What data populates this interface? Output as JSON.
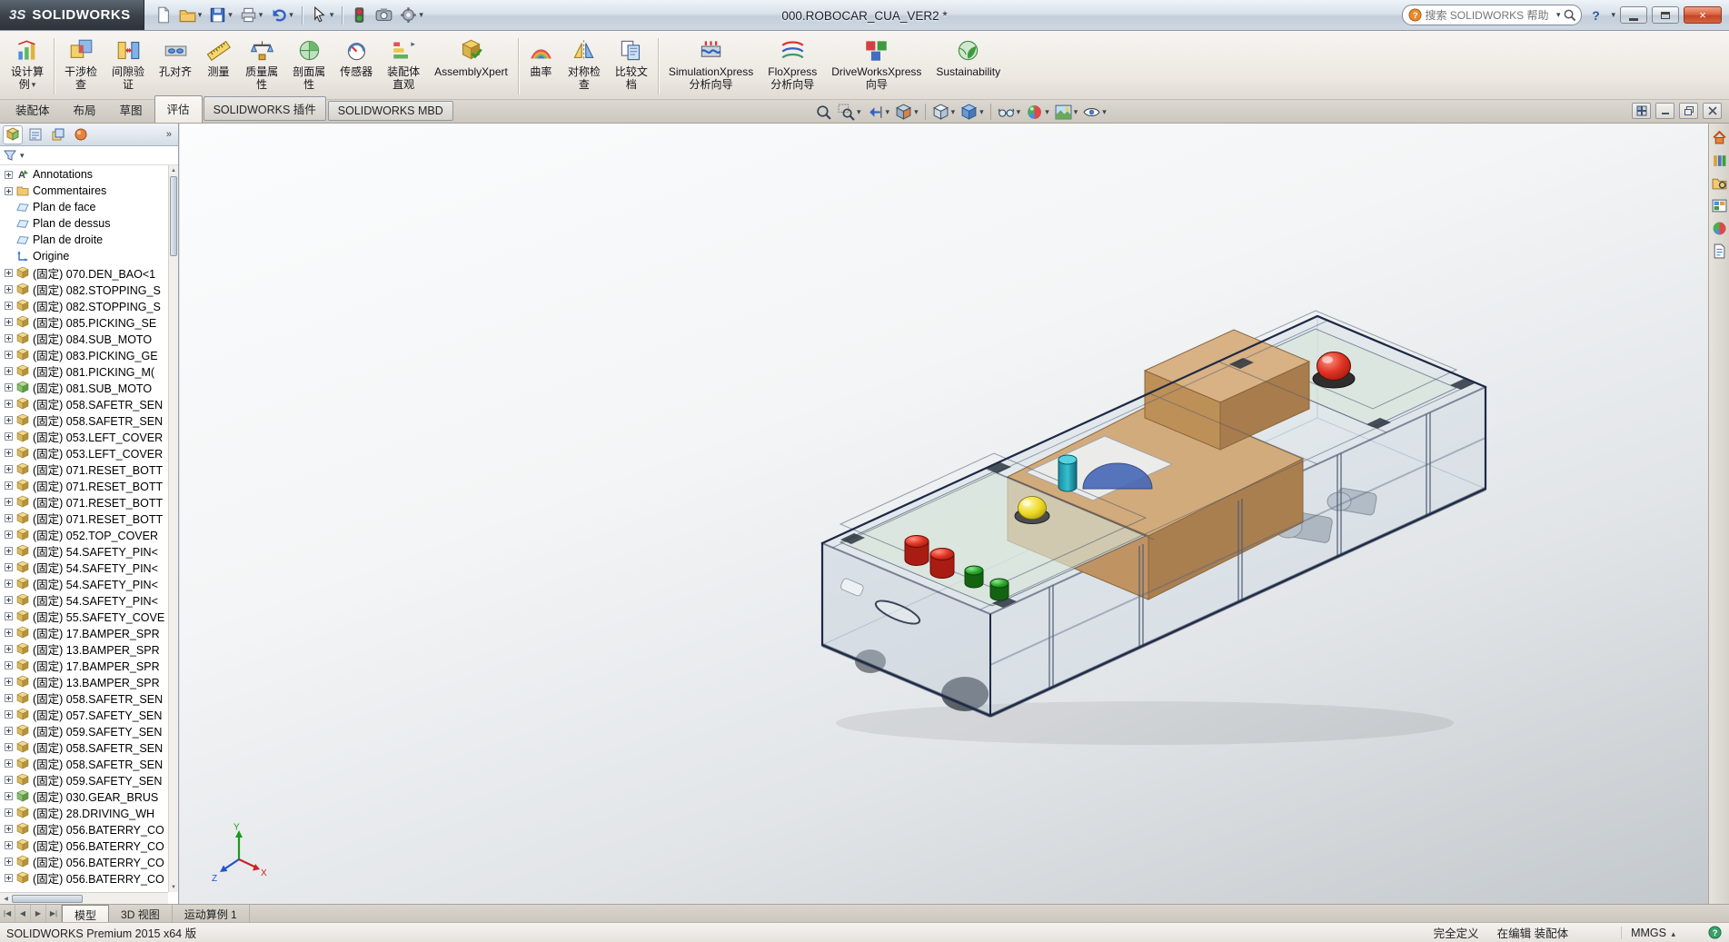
{
  "glyphs": {
    "caret_down": "▾",
    "caret_up": "▴",
    "chevron": "»",
    "up": "▲",
    "down": "▼",
    "left": "◀",
    "right": "▶"
  },
  "window": {
    "brand_mark": "3S",
    "brand": "SOLIDWORKS",
    "title": "000.ROBOCAR_CUA_VER2 *",
    "search": {
      "placeholder": "搜索 SOLIDWORKS 帮助"
    },
    "controls": {
      "help": "?",
      "close": "×"
    }
  },
  "quick_access": [
    {
      "icon": "new-document"
    },
    {
      "icon": "open-folder",
      "caret": true
    },
    {
      "icon": "save",
      "caret": true
    },
    {
      "icon": "print",
      "caret": true
    },
    {
      "icon": "undo",
      "caret": true
    },
    {
      "icon": "sep"
    },
    {
      "icon": "select-cursor",
      "caret": true
    },
    {
      "icon": "sep"
    },
    {
      "icon": "rebuild"
    },
    {
      "icon": "screen-capture"
    },
    {
      "icon": "options-gear",
      "caret": true
    }
  ],
  "ribbon": {
    "buttons": [
      {
        "icon": "design-study",
        "lines": [
          "设计算",
          "例"
        ],
        "caret": true,
        "sep_after": true
      },
      {
        "icon": "interference-check",
        "lines": [
          "干涉检",
          "查"
        ]
      },
      {
        "icon": "clearance-verify",
        "lines": [
          "间隙验",
          "证"
        ]
      },
      {
        "icon": "hole-alignment",
        "lines": [
          "孔对齐"
        ]
      },
      {
        "icon": "measure",
        "lines": [
          "测量"
        ]
      },
      {
        "icon": "mass-properties",
        "lines": [
          "质量属",
          "性"
        ]
      },
      {
        "icon": "section-properties",
        "lines": [
          "剖面属",
          "性"
        ]
      },
      {
        "icon": "sensor",
        "lines": [
          "传感器"
        ]
      },
      {
        "icon": "assembly-visualization",
        "lines": [
          "装配体",
          "直观"
        ]
      },
      {
        "icon": "assembly-xpert",
        "lines": [
          "AssemblyXpert"
        ],
        "sep_after": true
      },
      {
        "icon": "curvature",
        "lines": [
          "曲率"
        ]
      },
      {
        "icon": "symmetry-check",
        "lines": [
          "对称检",
          "查"
        ]
      },
      {
        "icon": "compare-documents",
        "lines": [
          "比较文",
          "档"
        ],
        "sep_after": true
      },
      {
        "icon": "simulationxpress",
        "lines": [
          "SimulationXpress",
          "分析向导"
        ]
      },
      {
        "icon": "floxpress",
        "lines": [
          "FloXpress",
          "分析向导"
        ]
      },
      {
        "icon": "driveworksxpress",
        "lines": [
          "DriveWorksXpress",
          "向导"
        ]
      },
      {
        "icon": "sustainability",
        "lines": [
          "Sustainability"
        ]
      }
    ]
  },
  "command_tabs": [
    {
      "label": "装配体"
    },
    {
      "label": "布局"
    },
    {
      "label": "草图"
    },
    {
      "label": "评估",
      "active": true
    },
    {
      "label": "SOLIDWORKS 插件",
      "boxed": true
    },
    {
      "label": "SOLIDWORKS MBD",
      "boxed": true
    }
  ],
  "headsup": [
    {
      "icon": "zoom-fit"
    },
    {
      "icon": "zoom-area",
      "caret": true
    },
    {
      "icon": "previous-view",
      "caret": true
    },
    {
      "icon": "section-view",
      "caret": true
    },
    {
      "icon": "sep"
    },
    {
      "icon": "view-orientation",
      "caret": true
    },
    {
      "icon": "display-style",
      "caret": true
    },
    {
      "icon": "sep"
    },
    {
      "icon": "hide-show-items",
      "caret": true
    },
    {
      "icon": "edit-appearance",
      "caret": true
    },
    {
      "icon": "apply-scene",
      "caret": true
    },
    {
      "icon": "view-settings",
      "caret": true
    }
  ],
  "document_controls": [
    {
      "icon": "doc-tile"
    },
    {
      "icon": "doc-minimize"
    },
    {
      "icon": "doc-restore"
    },
    {
      "icon": "doc-close"
    }
  ],
  "panel": {
    "tabs": [
      {
        "icon": "featuremanager-tab",
        "active": true
      },
      {
        "icon": "propertymanager-tab"
      },
      {
        "icon": "configurationmanager-tab"
      },
      {
        "icon": "displaymanager-tab"
      }
    ]
  },
  "tree": {
    "items": [
      {
        "icon": "annotations",
        "label": "Annotations",
        "expandable": true
      },
      {
        "icon": "comments",
        "label": "Commentaires",
        "expandable": true
      },
      {
        "icon": "plane",
        "label": "Plan de face",
        "expandable": false
      },
      {
        "icon": "plane",
        "label": "Plan de dessus",
        "expandable": false
      },
      {
        "icon": "plane",
        "label": "Plan de droite",
        "expandable": false
      },
      {
        "icon": "origin",
        "label": "Origine",
        "expandable": false
      },
      {
        "icon": "part",
        "label": "(固定) 070.DEN_BAO<1",
        "expandable": true
      },
      {
        "icon": "part",
        "label": "(固定) 082.STOPPING_S",
        "expandable": true
      },
      {
        "icon": "part",
        "label": "(固定) 082.STOPPING_S",
        "expandable": true
      },
      {
        "icon": "part",
        "label": "(固定) 085.PICKING_SE",
        "expandable": true
      },
      {
        "icon": "part",
        "label": "(固定) 084.SUB_MOTO",
        "expandable": true
      },
      {
        "icon": "part",
        "label": "(固定) 083.PICKING_GE",
        "expandable": true
      },
      {
        "icon": "part",
        "label": "(固定) 081.PICKING_M(",
        "expandable": true
      },
      {
        "icon": "part-green",
        "label": "(固定) 081.SUB_MOTO",
        "expandable": true
      },
      {
        "icon": "part",
        "label": "(固定) 058.SAFETR_SEN",
        "expandable": true
      },
      {
        "icon": "part",
        "label": "(固定) 058.SAFETR_SEN",
        "expandable": true
      },
      {
        "icon": "part",
        "label": "(固定) 053.LEFT_COVER",
        "expandable": true
      },
      {
        "icon": "part",
        "label": "(固定) 053.LEFT_COVER",
        "expandable": true
      },
      {
        "icon": "part",
        "label": "(固定) 071.RESET_BOTT",
        "expandable": true
      },
      {
        "icon": "part",
        "label": "(固定) 071.RESET_BOTT",
        "expandable": true
      },
      {
        "icon": "part",
        "label": "(固定) 071.RESET_BOTT",
        "expandable": true
      },
      {
        "icon": "part",
        "label": "(固定) 071.RESET_BOTT",
        "expandable": true
      },
      {
        "icon": "part",
        "label": "(固定) 052.TOP_COVER",
        "expandable": true
      },
      {
        "icon": "part",
        "label": "(固定) 54.SAFETY_PIN<",
        "expandable": true
      },
      {
        "icon": "part",
        "label": "(固定) 54.SAFETY_PIN<",
        "expandable": true
      },
      {
        "icon": "part",
        "label": "(固定) 54.SAFETY_PIN<",
        "expandable": true
      },
      {
        "icon": "part",
        "label": "(固定) 54.SAFETY_PIN<",
        "expandable": true
      },
      {
        "icon": "part",
        "label": "(固定) 55.SAFETY_COVE",
        "expandable": true
      },
      {
        "icon": "part",
        "label": "(固定) 17.BAMPER_SPR",
        "expandable": true
      },
      {
        "icon": "part",
        "label": "(固定) 13.BAMPER_SPR",
        "expandable": true
      },
      {
        "icon": "part",
        "label": "(固定) 17.BAMPER_SPR",
        "expandable": true
      },
      {
        "icon": "part",
        "label": "(固定) 13.BAMPER_SPR",
        "expandable": true
      },
      {
        "icon": "part",
        "label": "(固定) 058.SAFETR_SEN",
        "expandable": true
      },
      {
        "icon": "part",
        "label": "(固定) 057.SAFETY_SEN",
        "expandable": true
      },
      {
        "icon": "part",
        "label": "(固定) 059.SAFETY_SEN",
        "expandable": true
      },
      {
        "icon": "part",
        "label": "(固定) 058.SAFETR_SEN",
        "expandable": true
      },
      {
        "icon": "part",
        "label": "(固定) 058.SAFETR_SEN",
        "expandable": true
      },
      {
        "icon": "part",
        "label": "(固定) 059.SAFETY_SEN",
        "expandable": true
      },
      {
        "icon": "part-green",
        "label": "(固定) 030.GEAR_BRUS",
        "expandable": true
      },
      {
        "icon": "part",
        "label": "(固定) 28.DRIVING_WH",
        "expandable": true
      },
      {
        "icon": "part",
        "label": "(固定) 056.BATERRY_CO",
        "expandable": true
      },
      {
        "icon": "part",
        "label": "(固定) 056.BATERRY_CO",
        "expandable": true
      },
      {
        "icon": "part",
        "label": "(固定) 056.BATERRY_CO",
        "expandable": true
      },
      {
        "icon": "part",
        "label": "(固定) 056.BATERRY_CO",
        "expandable": true
      }
    ]
  },
  "task_pane": [
    {
      "icon": "resources"
    },
    {
      "icon": "design-library"
    },
    {
      "icon": "file-explorer"
    },
    {
      "icon": "view-palette"
    },
    {
      "icon": "appearances-scenes"
    },
    {
      "icon": "custom-properties"
    }
  ],
  "triad": {
    "x": "X",
    "y": "Y",
    "z": "Z"
  },
  "bottom": {
    "nav": [
      "|◀",
      "◀",
      "▶",
      "▶|"
    ],
    "tabs": [
      {
        "label": "模型",
        "active": true
      },
      {
        "label": "3D 视图"
      },
      {
        "label": "运动算例 1"
      }
    ]
  },
  "status": {
    "product": "SOLIDWORKS Premium 2015 x64 版",
    "define_state": "完全定义",
    "editing": "在编辑 装配体",
    "units": "MMGS"
  },
  "colors": {
    "estop_red": "#cc2020",
    "dome_yellow": "#e8d020",
    "button_green": "#2aa42a",
    "panel_tan": "#c9a271",
    "deck_green": "#d9e6da",
    "close_red": "#c24424"
  }
}
